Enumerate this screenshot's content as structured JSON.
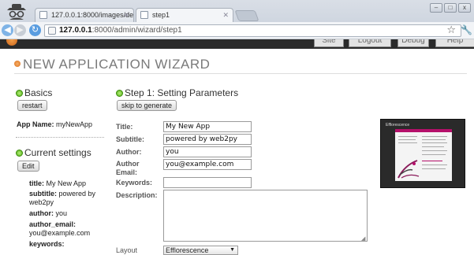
{
  "browser": {
    "tabs": [
      {
        "title": "127.0.0.1:8000/images/de",
        "active": false
      },
      {
        "title": "step1",
        "active": true
      }
    ],
    "address": {
      "host": "127.0.0.1",
      "path": ":8000/admin/wizard/step1"
    },
    "window_buttons": [
      "–",
      "□",
      "x"
    ]
  },
  "app_nav": {
    "buttons": [
      "Site",
      "Logout",
      "Debug",
      "Help"
    ]
  },
  "page": {
    "title": "NEW APPLICATION WIZARD",
    "basics": {
      "heading": "Basics",
      "restart_label": "restart",
      "app_name_label": "App Name:",
      "app_name_value": "myNewApp"
    },
    "current_settings": {
      "heading": "Current settings",
      "edit_label": "Edit",
      "items": [
        {
          "key": "title:",
          "value": "My New App"
        },
        {
          "key": "subtitle:",
          "value": "powered by web2py"
        },
        {
          "key": "author:",
          "value": "you"
        },
        {
          "key": "author_email:",
          "value": "you@example.com"
        },
        {
          "key": "keywords:",
          "value": ""
        }
      ]
    },
    "step": {
      "heading": "Step 1: Setting Parameters",
      "skip_label": "skip to generate",
      "fields": {
        "title": {
          "label": "Title:",
          "value": "My New App"
        },
        "subtitle": {
          "label": "Subtitle:",
          "value": "powered by web2py"
        },
        "author": {
          "label": "Author:",
          "value": "you"
        },
        "author_email": {
          "label": "Author Email:",
          "value": "you@example.com"
        },
        "keywords": {
          "label": "Keywords:",
          "value": ""
        },
        "description": {
          "label": "Description:",
          "value": ""
        },
        "layout": {
          "label": "Layout",
          "value": "Efflorescence"
        }
      }
    },
    "preview": {
      "header_text": "Efflorescence"
    }
  },
  "colors": {
    "accent_orange": "#dc6c16",
    "status_green": "#4fae14",
    "title_gray": "#7a7a7a",
    "preview_magenta": "#b5106a"
  }
}
